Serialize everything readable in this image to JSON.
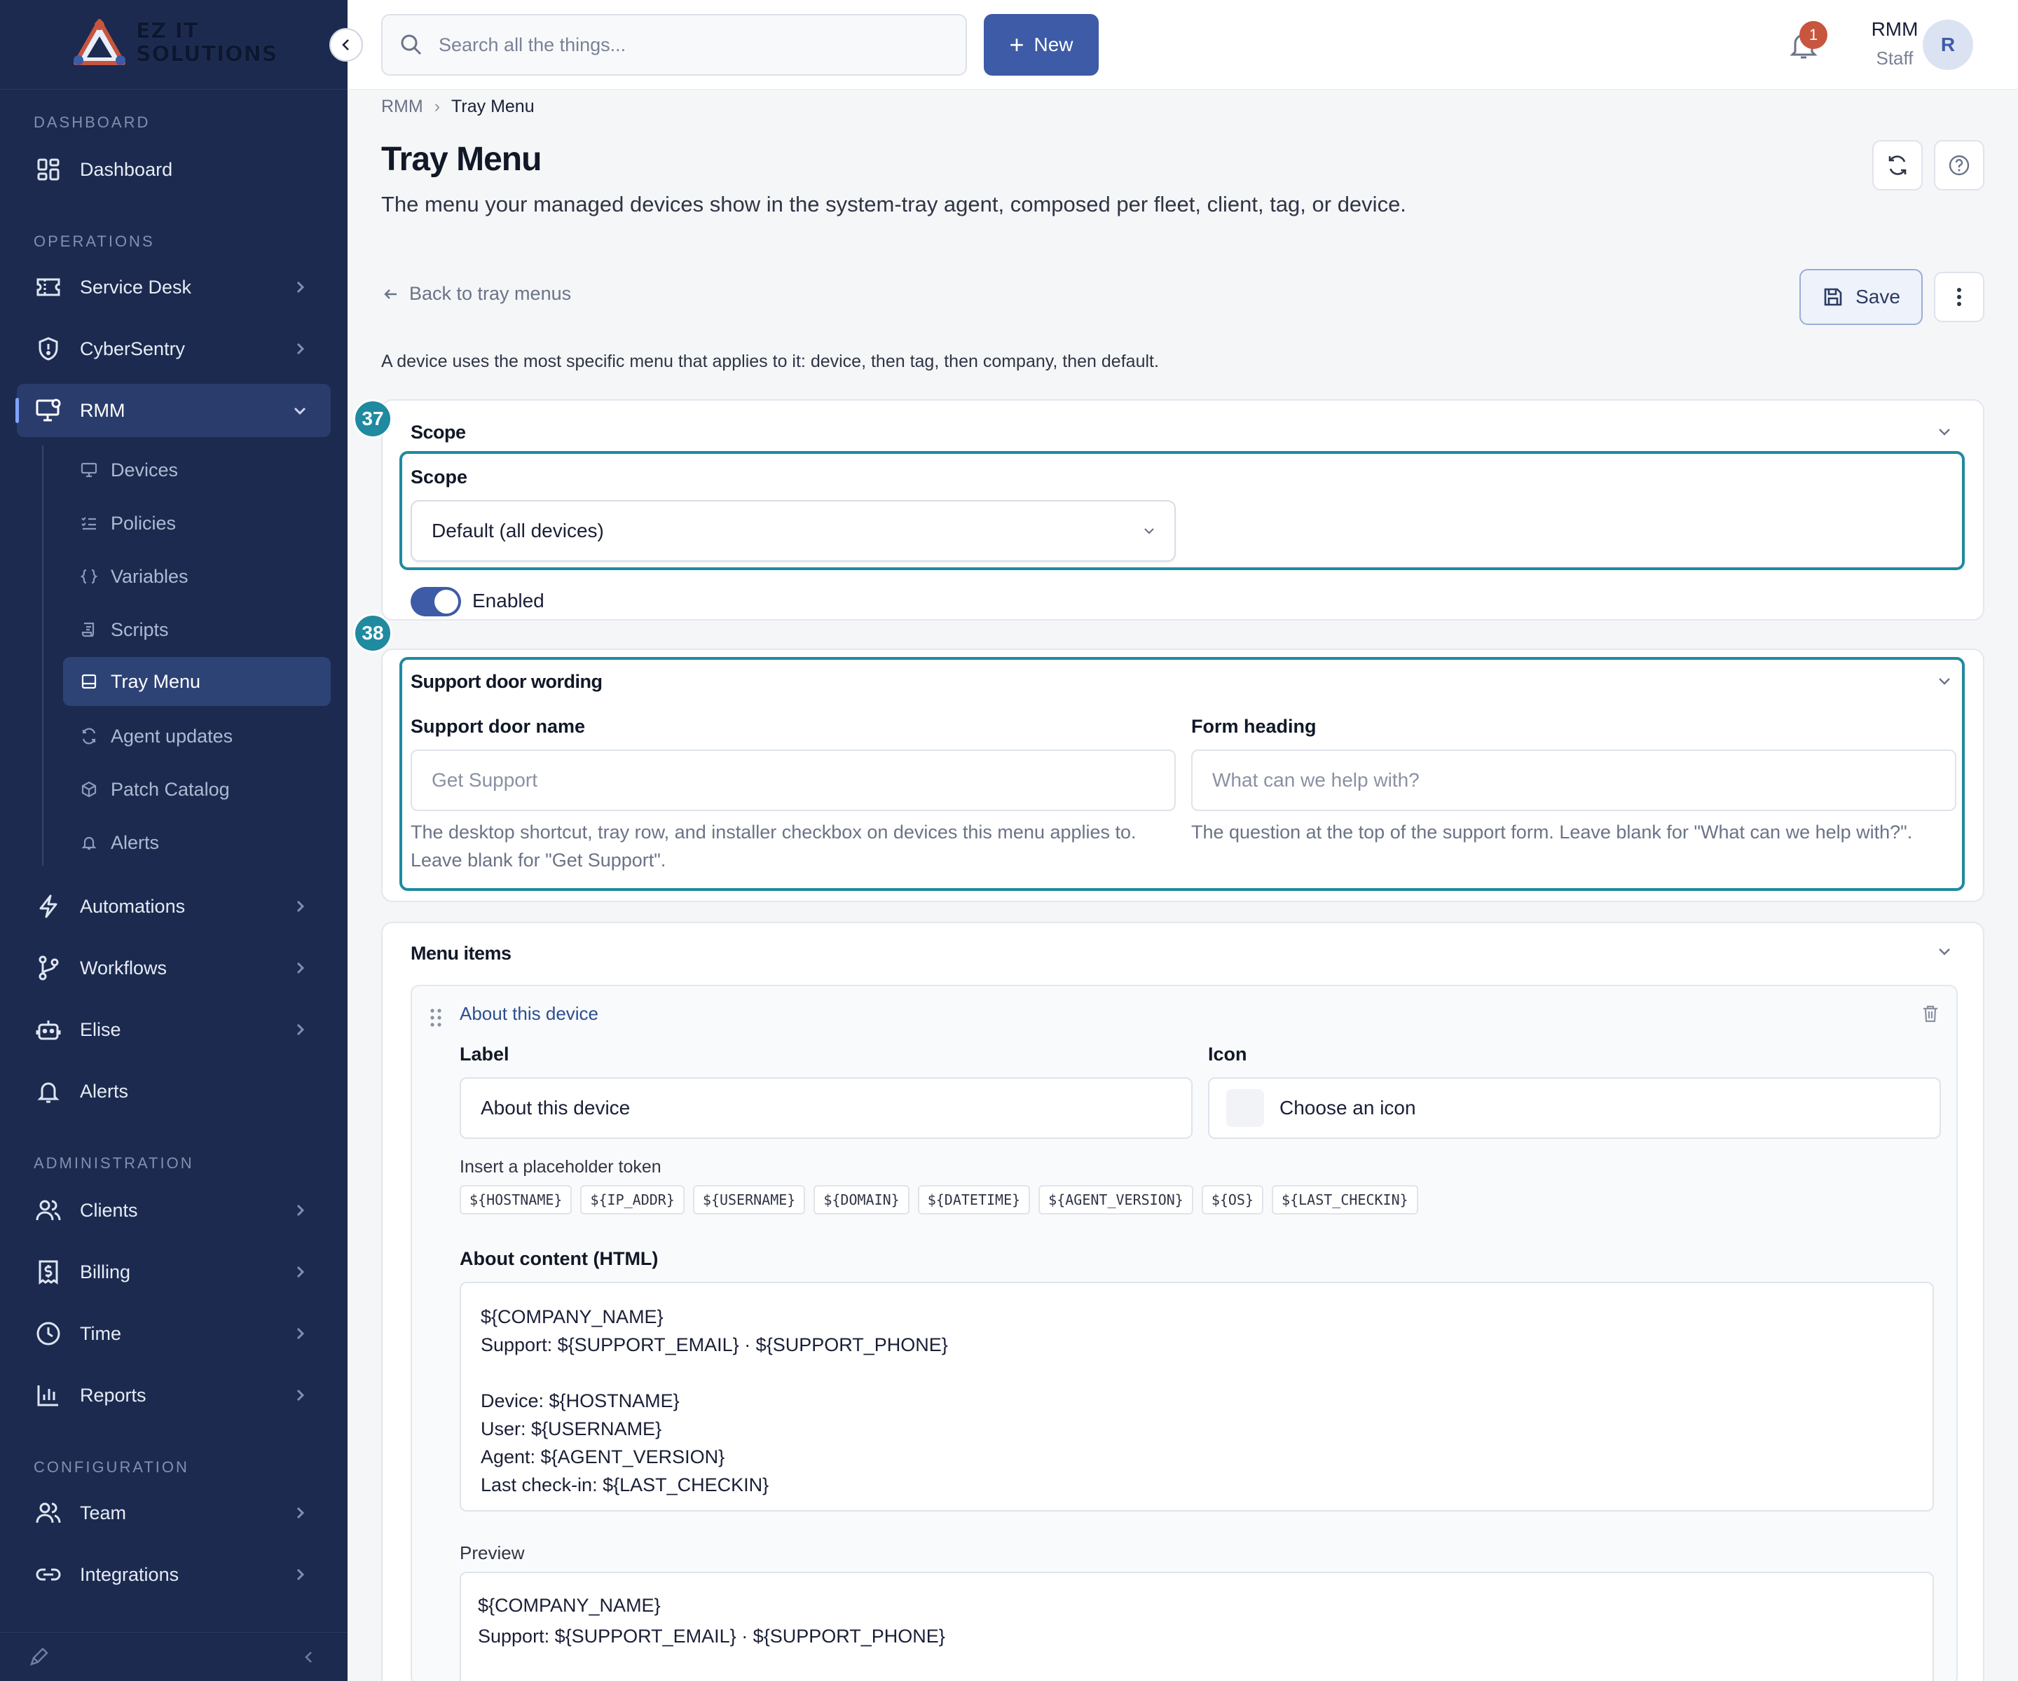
{
  "brand": {
    "name_line1": "EZ IT",
    "name_line2": "SOLUTIONS"
  },
  "sidebar": {
    "sections": {
      "dashboard": "DASHBOARD",
      "operations": "OPERATIONS",
      "administration": "ADMINISTRATION",
      "configuration": "CONFIGURATION"
    },
    "items": {
      "dashboard": "Dashboard",
      "service_desk": "Service Desk",
      "cybersentry": "CyberSentry",
      "rmm": "RMM",
      "automations": "Automations",
      "workflows": "Workflows",
      "elise": "Elise",
      "alerts": "Alerts",
      "clients": "Clients",
      "billing": "Billing",
      "time": "Time",
      "reports": "Reports",
      "team": "Team",
      "integrations": "Integrations"
    },
    "rmm_sub": {
      "devices": "Devices",
      "policies": "Policies",
      "variables": "Variables",
      "scripts": "Scripts",
      "tray_menu": "Tray Menu",
      "agent_updates": "Agent updates",
      "patch_catalog": "Patch Catalog",
      "alerts": "Alerts"
    }
  },
  "topbar": {
    "search_placeholder": "Search all the things...",
    "new_label": "New",
    "notification_count": "1",
    "user_name": "RMM",
    "user_role": "Staff",
    "avatar_initial": "R"
  },
  "breadcrumb": {
    "parent": "RMM",
    "current": "Tray Menu"
  },
  "page": {
    "title": "Tray Menu",
    "subtitle": "The menu your managed devices show in the system-tray agent, composed per fleet, client, tag, or device.",
    "back_label": "Back to tray menus",
    "save_label": "Save",
    "note": "A device uses the most specific menu that applies to it: device, then tag, then company, then default."
  },
  "markers": {
    "scope": "37",
    "support": "38"
  },
  "scope_card": {
    "title": "Scope",
    "field_label": "Scope",
    "selected": "Default (all devices)",
    "toggle_label": "Enabled"
  },
  "support_card": {
    "title": "Support door wording",
    "door_name_label": "Support door name",
    "door_name_placeholder": "Get Support",
    "door_name_help": "The desktop shortcut, tray row, and installer checkbox on devices this menu applies to. Leave blank for \"Get Support\".",
    "heading_label": "Form heading",
    "heading_placeholder": "What can we help with?",
    "heading_help": "The question at the top of the support form. Leave blank for \"What can we help with?\"."
  },
  "menu_card": {
    "title": "Menu items",
    "item_title": "About this device",
    "label_label": "Label",
    "label_value": "About this device",
    "icon_label": "Icon",
    "icon_placeholder": "Choose an icon",
    "token_label": "Insert a placeholder token",
    "tokens": [
      "${HOSTNAME}",
      "${IP_ADDR}",
      "${USERNAME}",
      "${DOMAIN}",
      "${DATETIME}",
      "${AGENT_VERSION}",
      "${OS}",
      "${LAST_CHECKIN}"
    ],
    "content_label": "About content (HTML)",
    "content": "${COMPANY_NAME}\nSupport: ${SUPPORT_EMAIL} · ${SUPPORT_PHONE}\n\nDevice: ${HOSTNAME}\nUser: ${USERNAME}\nAgent: ${AGENT_VERSION}\nLast check-in: ${LAST_CHECKIN}",
    "preview_label": "Preview",
    "preview": "${COMPANY_NAME}\nSupport: ${SUPPORT_EMAIL} · ${SUPPORT_PHONE}\n\nDevice: ${HOSTNAME}"
  },
  "colors": {
    "sidebar_bg": "#1b2a4e",
    "accent": "#3d5ba6",
    "highlight": "#1f8aa0",
    "badge": "#c8553d"
  }
}
